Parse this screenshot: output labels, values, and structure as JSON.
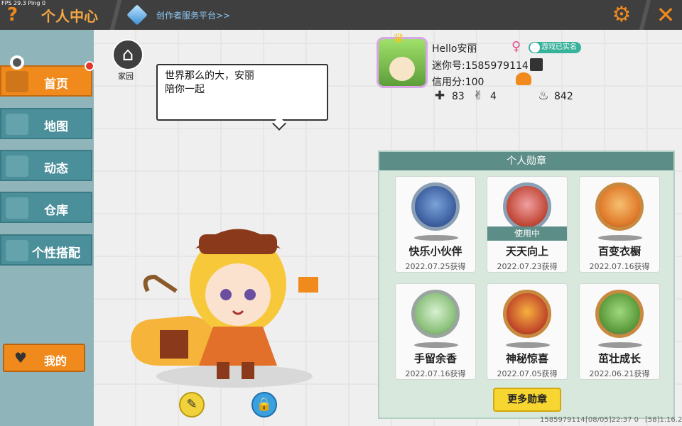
{
  "top_bar": {
    "fps": "FPS 29.3  Ping 0",
    "title": "个人中心",
    "creator_link": "创作者服务平台>>",
    "help_label": "?",
    "close_label": "✕",
    "settings_icon": "gear-icon"
  },
  "sidebar": {
    "items": [
      {
        "label": "首页",
        "icon": "character-icon",
        "active": true
      },
      {
        "label": "地图",
        "icon": "map-icon",
        "active": false
      },
      {
        "label": "动态",
        "icon": "bell-icon",
        "active": false
      },
      {
        "label": "仓库",
        "icon": "warehouse-icon",
        "active": false
      },
      {
        "label": "个性搭配",
        "icon": "outfit-icon",
        "active": false
      }
    ],
    "mine_label": "我的"
  },
  "home": {
    "label": "家园"
  },
  "speech_bubble": {
    "line1": "世界那么的大，安丽",
    "line2": "陪你一起"
  },
  "profile": {
    "nickname": "Hello安丽",
    "mini_id": "迷你号:1585979114",
    "credit": "信用分:100",
    "verify_badge": "游戏已实名",
    "stats": [
      {
        "icon": "plus-icon",
        "value": "83"
      },
      {
        "icon": "cheer-icon",
        "value": "4"
      },
      {
        "icon": "flame-icon",
        "value": "842"
      }
    ]
  },
  "medals": {
    "title": "个人勋章",
    "items": [
      {
        "name": "快乐小伙伴",
        "date": "2022.07.25获得",
        "in_use": false
      },
      {
        "name": "天天向上",
        "date": "2022.07.23获得",
        "in_use": true,
        "in_use_label": "使用中"
      },
      {
        "name": "百变衣橱",
        "date": "2022.07.16获得",
        "in_use": false
      },
      {
        "name": "手留余香",
        "date": "2022.07.16获得",
        "in_use": false
      },
      {
        "name": "神秘惊喜",
        "date": "2022.07.05获得",
        "in_use": false
      },
      {
        "name": "茁壮成长",
        "date": "2022.06.21获得",
        "in_use": false
      }
    ],
    "more_button": "更多勋章"
  },
  "footer": {
    "uid": "1585979114",
    "time": "[08/05]22:37 0",
    "version": "[58]1.16.2"
  },
  "colors": {
    "accent": "#f08a1c",
    "sidebar": "#4b8f9a",
    "panel_header": "#5c8d87",
    "more_button": "#f7d632"
  }
}
